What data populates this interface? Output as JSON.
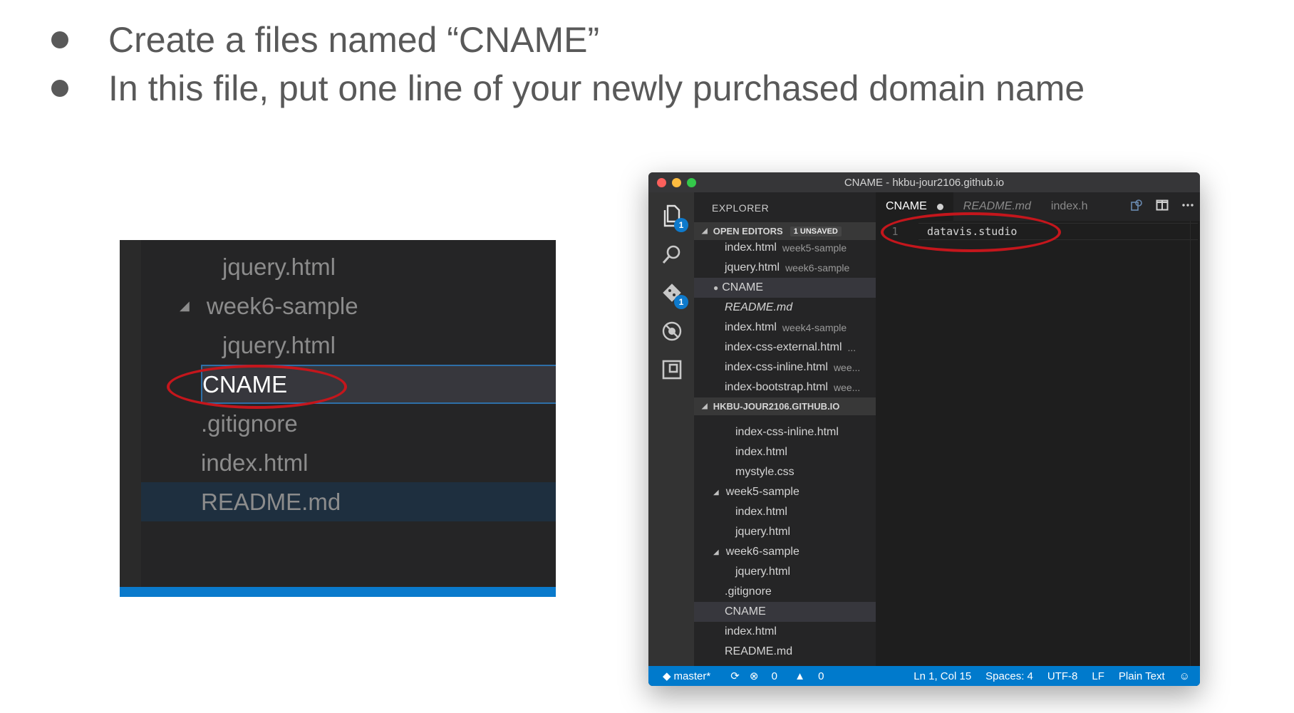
{
  "slide": {
    "bullets": [
      "Create a files named “CNAME”",
      "In this file, put one line of your newly purchased domain name"
    ]
  },
  "zoom": {
    "rows": [
      {
        "label": "jquery.html"
      },
      {
        "label": "week6-sample"
      },
      {
        "label": "jquery.html"
      },
      {
        "label": "CNAME"
      },
      {
        "label": ".gitignore"
      },
      {
        "label": "index.html"
      },
      {
        "label": "README.md"
      }
    ]
  },
  "window": {
    "title": "CNAME - hkbu-jour2106.github.io",
    "activity": {
      "explorer_badge": "1",
      "git_badge": "1",
      "icons": [
        "files-icon",
        "search-icon",
        "git-icon",
        "debug-icon",
        "extensions-icon"
      ]
    },
    "sidebar": {
      "title": "EXPLORER",
      "open_editors": {
        "header": "OPEN EDITORS",
        "badge": "1 UNSAVED",
        "items": [
          {
            "label": "index.html",
            "desc": "week5-sample"
          },
          {
            "label": "jquery.html",
            "desc": "week6-sample"
          },
          {
            "label": "CNAME",
            "desc": ""
          },
          {
            "label": "README.md",
            "desc": ""
          },
          {
            "label": "index.html",
            "desc": "week4-sample"
          },
          {
            "label": "index-css-external.html",
            "desc": "..."
          },
          {
            "label": "index-css-inline.html",
            "desc": "wee..."
          },
          {
            "label": "index-bootstrap.html",
            "desc": "wee..."
          }
        ]
      },
      "folder": {
        "header": "HKBU-JOUR2106.GITHUB.IO",
        "items": [
          {
            "label": "index-css-inline.html"
          },
          {
            "label": "index.html"
          },
          {
            "label": "mystyle.css"
          },
          {
            "label": "week5-sample"
          },
          {
            "label": "index.html"
          },
          {
            "label": "jquery.html"
          },
          {
            "label": "week6-sample"
          },
          {
            "label": "jquery.html"
          },
          {
            "label": ".gitignore"
          },
          {
            "label": "CNAME"
          },
          {
            "label": "index.html"
          },
          {
            "label": "README.md"
          }
        ]
      }
    },
    "tabs": [
      {
        "label": "CNAME"
      },
      {
        "label": "README.md"
      },
      {
        "label": "index.h"
      }
    ],
    "editor": {
      "line_number": "1",
      "content": "datavis.studio"
    },
    "status": {
      "branch": "master*",
      "errors": "0",
      "warnings": "0",
      "position": "Ln 1, Col 15",
      "spaces": "Spaces: 4",
      "encoding": "UTF-8",
      "eol": "LF",
      "language": "Plain Text"
    },
    "colors": {
      "close": "#fc605c",
      "minimize": "#fdbc40",
      "maximize": "#34c84a",
      "statusbar": "#007acc",
      "highlight_ring": "#c4161c"
    }
  }
}
